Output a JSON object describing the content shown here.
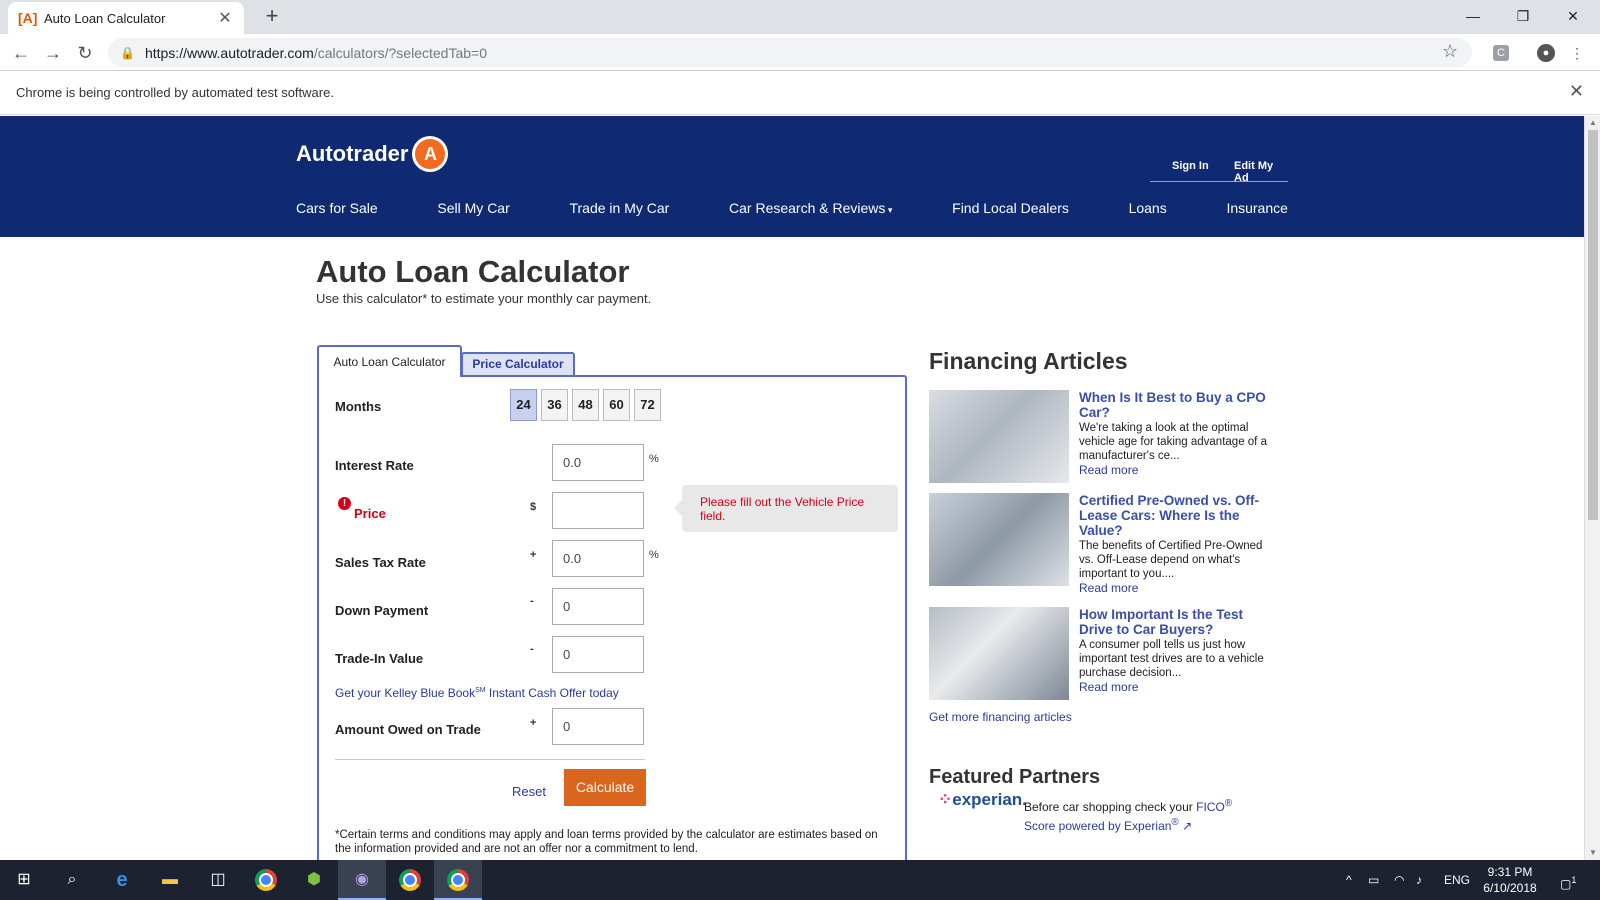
{
  "browser": {
    "tab_title": "Auto Loan Calculator",
    "url_host": "https://www.autotrader.com",
    "url_path": "/calculators/?selectedTab=0",
    "infobar_message": "Chrome is being controlled by automated test software."
  },
  "site": {
    "logo_text": "Autotrader",
    "header_links": [
      "Sign In",
      "Edit My Ad"
    ],
    "nav": [
      "Cars for Sale",
      "Sell My Car",
      "Trade in My Car",
      "Car Research & Reviews",
      "Find Local Dealers",
      "Loans",
      "Insurance"
    ]
  },
  "page": {
    "title": "Auto Loan Calculator",
    "subtitle": "Use this calculator* to estimate your monthly car payment."
  },
  "calculator": {
    "tabs": [
      "Auto Loan Calculator",
      "Price Calculator"
    ],
    "months_label": "Months",
    "months": [
      "24",
      "36",
      "48",
      "60",
      "72"
    ],
    "selected_month": "24",
    "fields": {
      "interest_rate": {
        "label": "Interest Rate",
        "value": "0.0",
        "unit": "%"
      },
      "price": {
        "label": "Price",
        "value": "",
        "symbol": "$"
      },
      "sales_tax": {
        "label": "Sales Tax Rate",
        "value": "0.0",
        "symbol": "+",
        "unit": "%"
      },
      "down_payment": {
        "label": "Down Payment",
        "value": "0",
        "symbol": "-"
      },
      "trade_in": {
        "label": "Trade-In Value",
        "value": "0",
        "symbol": "-"
      },
      "amount_owed": {
        "label": "Amount Owed on Trade",
        "value": "0",
        "symbol": "+"
      }
    },
    "price_error": "Please fill out the Vehicle Price field.",
    "kbb_link_a": "Get your Kelley Blue Book",
    "kbb_sup": "SM",
    "kbb_link_b": " Instant Cash Offer today",
    "reset_label": "Reset",
    "calculate_label": "Calculate",
    "terms": "*Certain terms and conditions may apply and loan terms provided by the calculator are estimates based on the information provided and are not an offer nor a commitment to lend."
  },
  "articles": {
    "heading": "Financing Articles",
    "items": [
      {
        "title": "When Is It Best to Buy a CPO Car?",
        "body": "We're taking a look at the optimal vehicle age for taking advantage of a manufacturer's ce...",
        "more": "Read more"
      },
      {
        "title": "Certified Pre-Owned vs. Off-Lease Cars: Where Is the Value?",
        "body": "The benefits of Certified Pre-Owned vs. Off-Lease depend on what's important to you....",
        "more": "Read more"
      },
      {
        "title": "How Important Is the Test Drive to Car Buyers?",
        "body": "A consumer poll tells us just how important test drives are to a vehicle purchase decision...",
        "more": "Read more"
      }
    ],
    "more_link": "Get more financing articles"
  },
  "partners": {
    "heading": "Featured Partners",
    "experian_logo": "experian.",
    "text_a": "Before car shopping check your ",
    "fico": "FICO",
    "fico_sup": "®",
    "text_b": "Score powered by Experian",
    "text_b_sup": "®"
  },
  "taskbar": {
    "language": "ENG",
    "time": "9:31 PM",
    "date": "6/10/2018",
    "notifications": "1"
  }
}
